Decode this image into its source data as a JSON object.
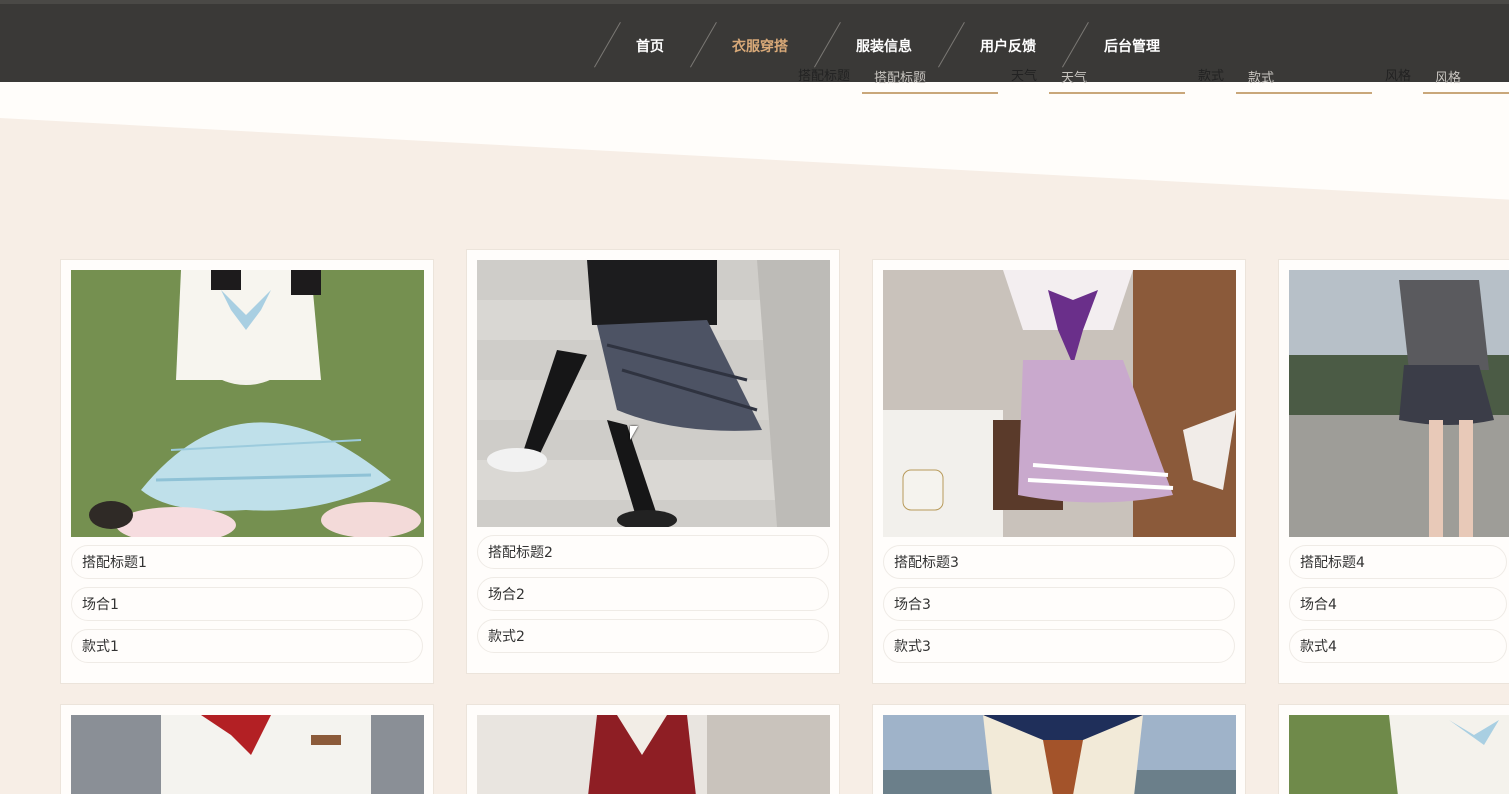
{
  "nav": {
    "items": [
      {
        "label": "首页",
        "active": false
      },
      {
        "label": "衣服穿搭",
        "active": true
      },
      {
        "label": "服装信息",
        "active": false
      },
      {
        "label": "用户反馈",
        "active": false
      },
      {
        "label": "后台管理",
        "active": false
      }
    ]
  },
  "filters": [
    {
      "label": "搭配标题",
      "placeholder": "搭配标题"
    },
    {
      "label": "天气",
      "placeholder": "天气"
    },
    {
      "label": "款式",
      "placeholder": "款式"
    },
    {
      "label": "风格",
      "placeholder": "风格"
    }
  ],
  "cards": [
    {
      "title": "搭配标题1",
      "occasion": "场合1",
      "style": "款式1"
    },
    {
      "title": "搭配标题2",
      "occasion": "场合2",
      "style": "款式2"
    },
    {
      "title": "搭配标题3",
      "occasion": "场合3",
      "style": "款式3"
    },
    {
      "title": "搭配标题4",
      "occasion": "场合4",
      "style": "款式4"
    }
  ],
  "colors": {
    "nav_bg": "#3a3937",
    "nav_active": "#d8a978",
    "page_bg": "#f7eee6",
    "accent_underline": "#c9a77a"
  }
}
